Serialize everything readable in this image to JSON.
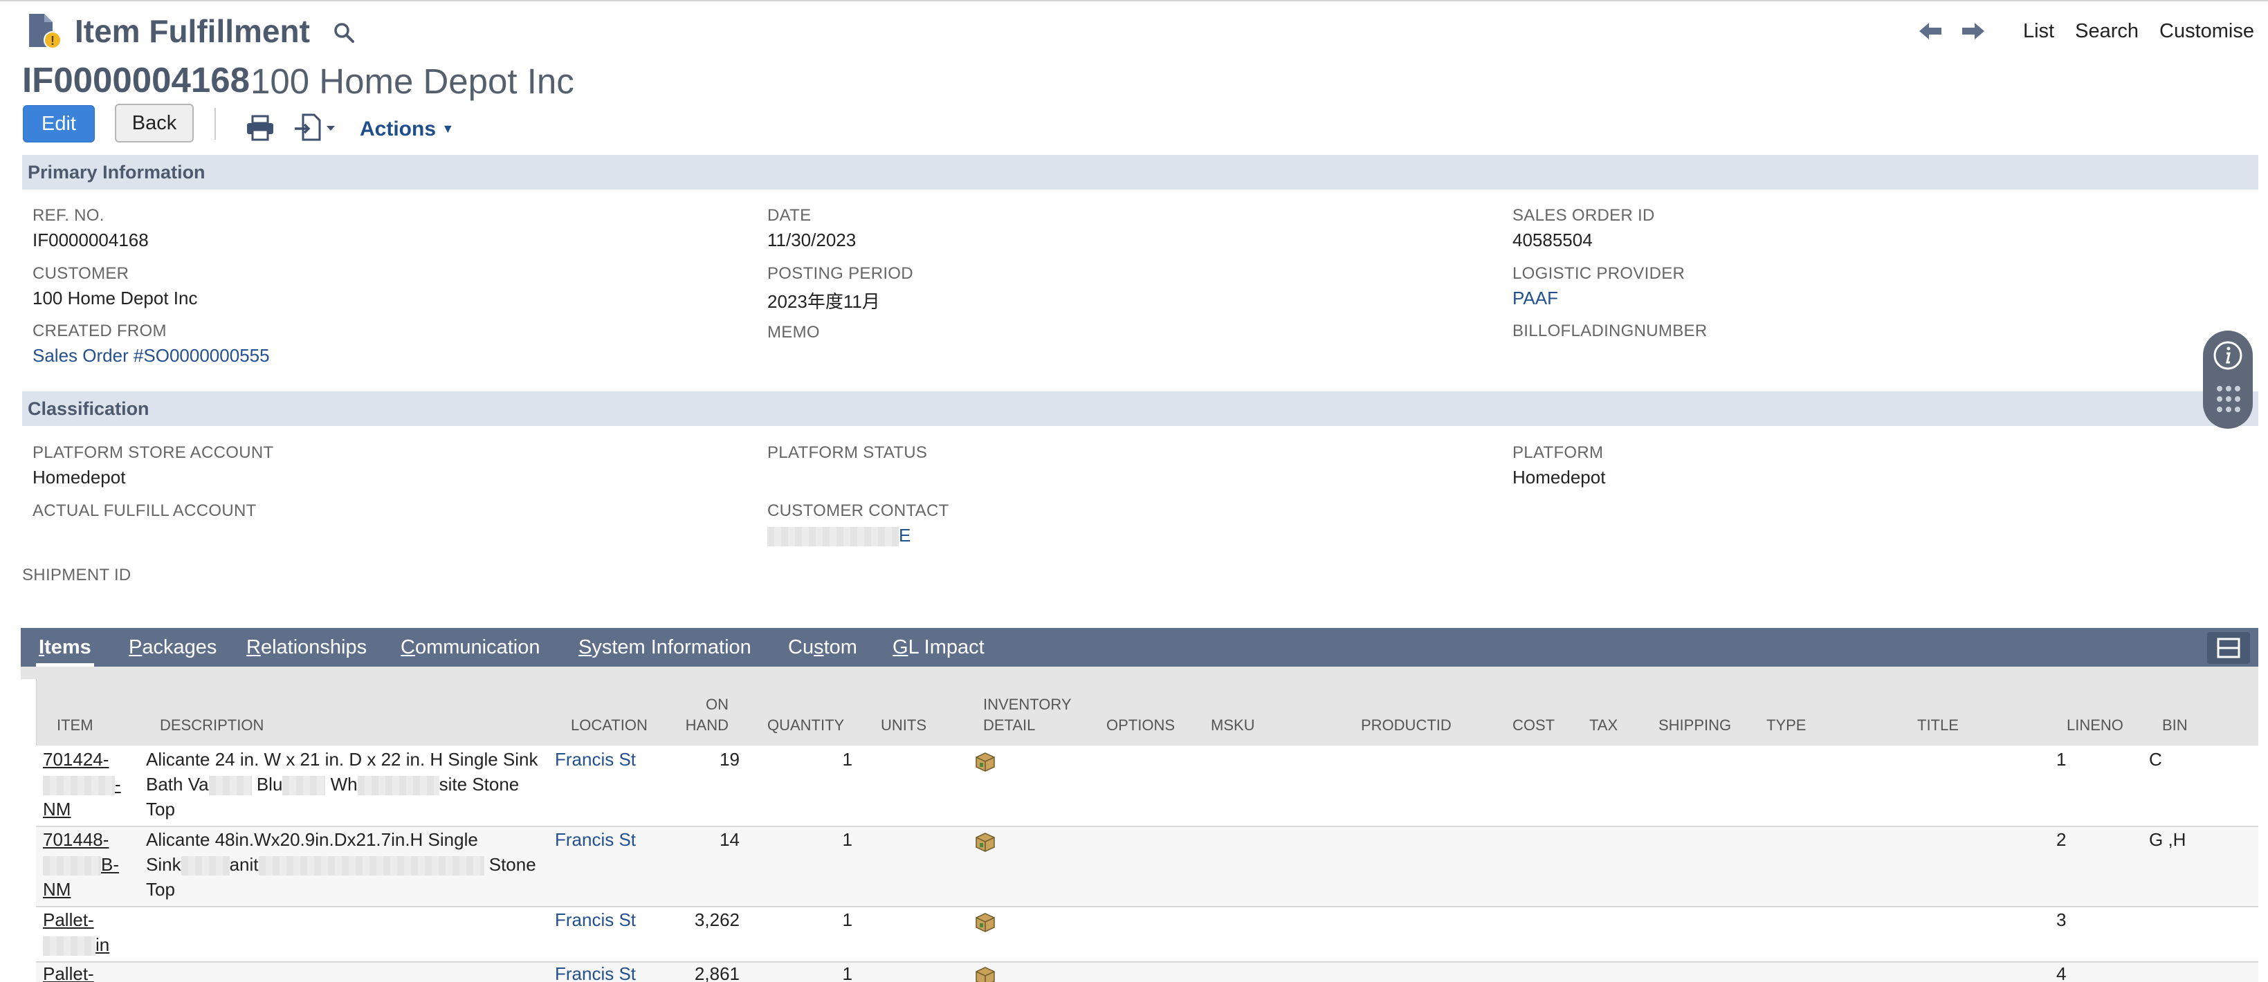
{
  "header": {
    "title": "Item Fulfillment",
    "record_id": "IF0000004168",
    "record_name": "100 Home Depot Inc",
    "nav": [
      "List",
      "Search",
      "Customise"
    ]
  },
  "toolbar": {
    "edit": "Edit",
    "back": "Back",
    "actions": "Actions"
  },
  "sections": {
    "primary": "Primary Information",
    "classification": "Classification"
  },
  "primary": {
    "ref_no": {
      "label": "REF. NO.",
      "value": "IF0000004168"
    },
    "date": {
      "label": "DATE",
      "value": "11/30/2023"
    },
    "sales_order_id": {
      "label": "SALES ORDER ID",
      "value": "40585504"
    },
    "customer": {
      "label": "CUSTOMER",
      "value": "100 Home Depot Inc"
    },
    "posting_period": {
      "label": "POSTING PERIOD",
      "value": "2023年度11月"
    },
    "logistic_provider": {
      "label": "LOGISTIC PROVIDER",
      "value": "PAAF"
    },
    "created_from": {
      "label": "CREATED FROM",
      "value": "Sales Order #SO0000000555"
    },
    "memo": {
      "label": "MEMO",
      "value": ""
    },
    "bill_of_lading": {
      "label": "BILLOFLADINGNUMBER",
      "value": ""
    }
  },
  "classification": {
    "platform_store_account": {
      "label": "PLATFORM STORE ACCOUNT",
      "value": "Homedepot"
    },
    "platform_status": {
      "label": "PLATFORM STATUS",
      "value": ""
    },
    "platform": {
      "label": "PLATFORM",
      "value": "Homedepot"
    },
    "actual_fulfill_account": {
      "label": "ACTUAL FULFILL ACCOUNT",
      "value": ""
    },
    "customer_contact": {
      "label": "CUSTOMER CONTACT",
      "value_suffix": "E"
    },
    "shipment_id": {
      "label": "SHIPMENT ID",
      "value": ""
    }
  },
  "tabs": [
    {
      "first": "I",
      "rest": "tems"
    },
    {
      "first": "P",
      "rest": "ackages"
    },
    {
      "first": "R",
      "rest": "elationships"
    },
    {
      "first": "C",
      "rest": "ommunication"
    },
    {
      "first": "S",
      "rest": "ystem Information"
    },
    {
      "first": "Cu",
      "under": "s",
      "rest": "tom"
    },
    {
      "first": "G",
      "rest": "L Impact"
    }
  ],
  "table": {
    "headers": {
      "item": "ITEM",
      "description": "DESCRIPTION",
      "location": "LOCATION",
      "on_hand_1": "ON",
      "on_hand_2": "HAND",
      "quantity": "QUANTITY",
      "units": "UNITS",
      "inventory_1": "INVENTORY",
      "inventory_2": "DETAIL",
      "options": "OPTIONS",
      "msku": "MSKU",
      "productid": "PRODUCTID",
      "cost": "COST",
      "tax": "TAX",
      "shipping": "SHIPPING",
      "type": "TYPE",
      "title": "TITLE",
      "lineno": "LINENO",
      "bin": "BIN"
    },
    "rows": [
      {
        "item_l1": "701424-",
        "item_l3": "NM",
        "desc_l1": "Alicante 24 in. W x 21 in. D x 22 in. H Single Sink",
        "desc_l2a": "Bath Va",
        "desc_l2b": "Blu",
        "desc_l2c": "Wh",
        "desc_l2d": "site Stone",
        "desc_l3": "Top",
        "location": "Francis St",
        "on_hand": "19",
        "quantity": "1",
        "lineno": "1",
        "bin": "C"
      },
      {
        "item_l1": "701448-",
        "item_l2": "B-",
        "item_l3": "NM",
        "desc_l1": "Alicante 48in.Wx20.9in.Dx21.7in.H Single",
        "desc_l2a": "Sink",
        "desc_l2b": "anit",
        "desc_l2d": "Stone",
        "desc_l3": "Top",
        "location": "Francis St",
        "on_hand": "14",
        "quantity": "1",
        "lineno": "2",
        "bin": "G ,H"
      },
      {
        "item_l1": "Pallet-",
        "item_l2": "in",
        "location": "Francis St",
        "on_hand": "3,262",
        "quantity": "1",
        "lineno": "3"
      },
      {
        "item_l1": "Pallet-",
        "location": "Francis St",
        "on_hand": "2,861",
        "quantity": "1",
        "lineno": "4"
      }
    ]
  }
}
